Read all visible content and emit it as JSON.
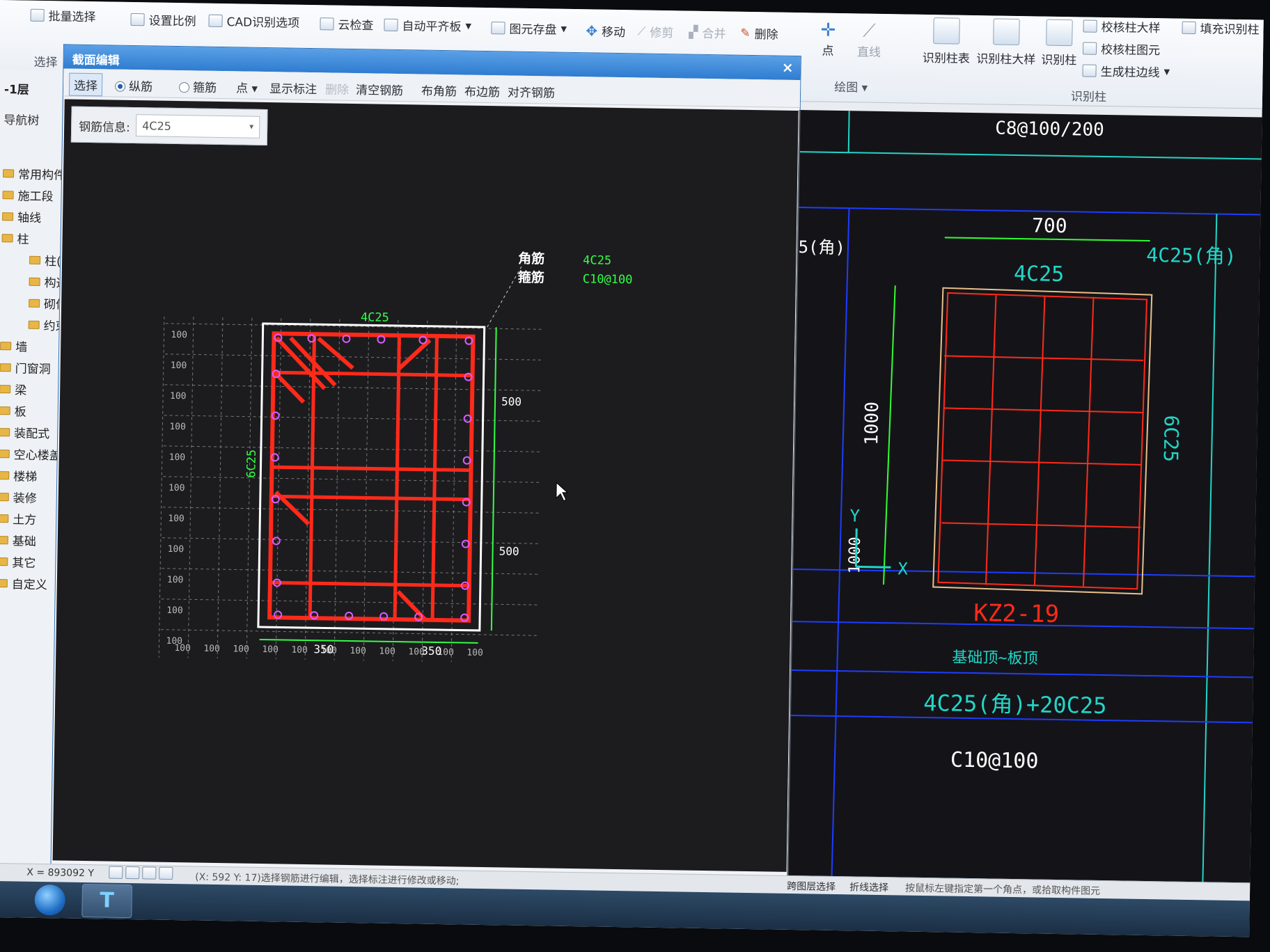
{
  "ribbon": {
    "batch_select": "批量选择",
    "set_scale": "设置比例",
    "cad_options": "CAD识别选项",
    "cloud_check": "云检查",
    "auto_align_slab": "自动平齐板",
    "element_save": "图元存盘",
    "move": "移动",
    "trim": "修剪",
    "merge": "合并",
    "delete": "删除",
    "select_group": "选择",
    "point": "点",
    "line": "直线",
    "draw_group": "绘图",
    "identify_col_table": "识别柱表",
    "identify_col_detail": "识别柱大样",
    "identify_col": "识别柱",
    "identify_group": "识别柱",
    "check_col_detail": "校核柱大样",
    "check_col_element": "校核柱图元",
    "gen_col_edge": "生成柱边线",
    "fill_identify_col": "填充识别柱"
  },
  "sidebar": {
    "floor": "-1层",
    "nav_tree": "导航树",
    "items": [
      "常用构件类型",
      "施工段",
      "轴线",
      "柱",
      "柱(Z)",
      "构造柱",
      "砌体柱",
      "约束边缘",
      "墙",
      "门窗洞",
      "梁",
      "板",
      "装配式",
      "空心楼盖",
      "楼梯",
      "装修",
      "土方",
      "基础",
      "其它",
      "自定义"
    ]
  },
  "dialog": {
    "title": "截面编辑",
    "close": "×",
    "toolbar": {
      "select": "选择",
      "longitudinal": "纵筋",
      "stirrup": "箍筋",
      "point": "点",
      "show_marks": "显示标注",
      "delete": "删除",
      "clear_rebar": "清空钢筋",
      "corner_rebar": "布角筋",
      "edge_rebar": "布边筋",
      "align_rebar": "对齐钢筋"
    },
    "rebar_info_label": "钢筋信息:",
    "rebar_info_value": "4C25"
  },
  "section": {
    "top_label": "4C25",
    "side_label": "6C25",
    "corner_title": "角筋",
    "stirrup_title": "箍筋",
    "corner_value": "4C25",
    "stirrup_value": "C10@100",
    "dim_right_top": "500",
    "dim_right_bottom": "500",
    "dim_bottom_left": "350",
    "dim_bottom_right": "350",
    "grid_label": "100"
  },
  "cad": {
    "top_text": "C8@100/200",
    "width_dim": "700",
    "height_dim": "1000",
    "top_rebar": "4C25",
    "corner_note": "4C25(角)",
    "side_rebar": "6C25",
    "left_cut": "5(角)",
    "name": "KZ2-19",
    "elevation": "基础顶~板顶",
    "longitudinal": "4C25(角)+20C25",
    "stirrup": "C10@100",
    "axis_y": "Y",
    "axis_x": "X"
  },
  "status": {
    "coords": "X = 893092 Y",
    "message": "(X: 592 Y: 17)选择钢筋进行编辑，选择标注进行修改或移动;",
    "cross_layer": "跨图层选择",
    "polyline_select": "折线选择",
    "hint": "按鼠标左键指定第一个角点，或拾取构件图元"
  },
  "colors": {
    "rebar": "#ff2a1a",
    "dimension": "#33ff44",
    "cad_blue": "#1f3cff",
    "cad_cyan": "#22d6c8"
  }
}
